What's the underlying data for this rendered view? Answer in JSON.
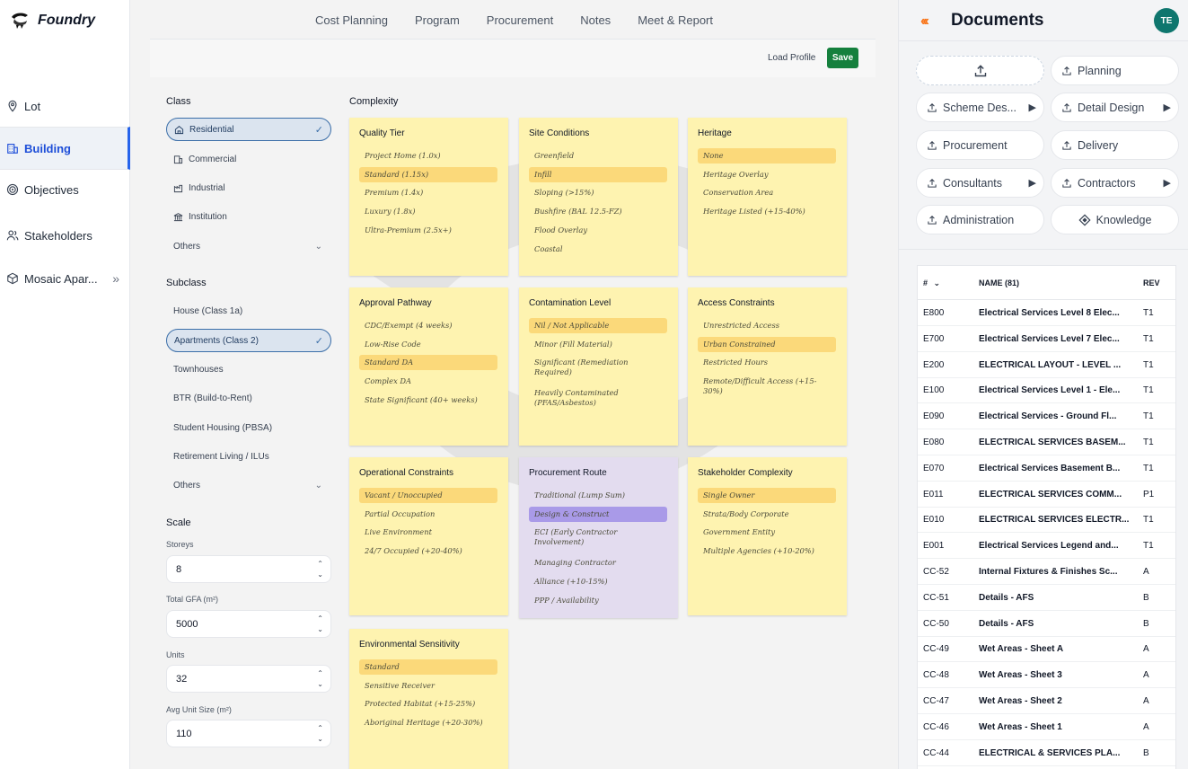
{
  "app": {
    "name": "Foundry"
  },
  "sidebar": {
    "items": [
      {
        "label": "Lot",
        "icon": "map-pin-icon"
      },
      {
        "label": "Building",
        "icon": "building-icon",
        "active": true
      },
      {
        "label": "Objectives",
        "icon": "target-icon"
      },
      {
        "label": "Stakeholders",
        "icon": "users-icon"
      },
      {
        "label": "Mosaic Apar...",
        "icon": "box-icon",
        "expand": "»"
      }
    ]
  },
  "topnav": {
    "tabs": [
      "Cost Planning",
      "Program",
      "Procurement",
      "Notes",
      "Meet & Report"
    ]
  },
  "toolbar": {
    "load_profile": "Load Profile",
    "save": "Save"
  },
  "class_section": {
    "label": "Class",
    "options": [
      {
        "label": "Residential",
        "selected": true
      },
      {
        "label": "Commercial"
      },
      {
        "label": "Industrial"
      },
      {
        "label": "Institution"
      },
      {
        "label": "Others"
      }
    ]
  },
  "subclass_section": {
    "label": "Subclass",
    "options": [
      {
        "label": "House (Class 1a)"
      },
      {
        "label": "Apartments (Class 2)",
        "selected": true
      },
      {
        "label": "Townhouses"
      },
      {
        "label": "BTR (Build-to-Rent)"
      },
      {
        "label": "Student Housing (PBSA)"
      },
      {
        "label": "Retirement Living / ILUs"
      },
      {
        "label": "Others"
      }
    ]
  },
  "scale": {
    "label": "Scale",
    "fields": [
      {
        "label": "Storeys",
        "value": "8"
      },
      {
        "label": "Total GFA (m²)",
        "value": "5000"
      },
      {
        "label": "Units",
        "value": "32"
      },
      {
        "label": "Avg Unit Size (m²)",
        "value": "110"
      }
    ]
  },
  "complexity": {
    "label": "Complexity",
    "cards": [
      {
        "title": "Quality Tier",
        "options": [
          "Project Home (1.0x)",
          "Standard (1.15x)",
          "Premium (1.4x)",
          "Luxury (1.8x)",
          "Ultra-Premium (2.5x+)"
        ],
        "selected": 1
      },
      {
        "title": "Site Conditions",
        "options": [
          "Greenfield",
          "Infill",
          "Sloping (>15%)",
          "Bushfire (BAL 12.5-FZ)",
          "Flood Overlay",
          "Coastal"
        ],
        "selected": 1
      },
      {
        "title": "Heritage",
        "options": [
          "None",
          "Heritage Overlay",
          "Conservation Area",
          "Heritage Listed (+15-40%)"
        ],
        "selected": 0
      },
      {
        "title": "Approval Pathway",
        "options": [
          "CDC/Exempt (4 weeks)",
          "Low-Rise Code",
          "Standard DA",
          "Complex DA",
          "State Significant (40+ weeks)"
        ],
        "selected": 2
      },
      {
        "title": "Contamination Level",
        "options": [
          "Nil / Not Applicable",
          "Minor (Fill Material)",
          "Significant (Remediation Required)",
          "Heavily Contaminated (PFAS/Asbestos)"
        ],
        "selected": 0
      },
      {
        "title": "Access Constraints",
        "options": [
          "Unrestricted Access",
          "Urban Constrained",
          "Restricted Hours",
          "Remote/Difficult Access (+15-30%)"
        ],
        "selected": 1
      },
      {
        "title": "Operational Constraints",
        "options": [
          "Vacant / Unoccupied",
          "Partial Occupation",
          "Live Environment",
          "24/7 Occupied (+20-40%)"
        ],
        "selected": 0
      },
      {
        "title": "Procurement Route",
        "options": [
          "Traditional (Lump Sum)",
          "Design & Construct",
          "ECI (Early Contractor Involvement)",
          "Managing Contractor",
          "Alliance (+10-15%)",
          "PPP / Availability"
        ],
        "selected": 1,
        "purple": true
      },
      {
        "title": "Stakeholder Complexity",
        "options": [
          "Single Owner",
          "Strata/Body Corporate",
          "Government Entity",
          "Multiple Agencies (+10-20%)"
        ],
        "selected": 0
      },
      {
        "title": "Environmental Sensitivity",
        "options": [
          "Standard",
          "Sensitive Receiver",
          "Protected Habitat (+15-25%)",
          "Aboriginal Heritage (+20-30%)"
        ],
        "selected": 0
      }
    ]
  },
  "documents": {
    "title": "Documents",
    "avatar": "TE",
    "categories": [
      {
        "label": "",
        "type": "upload"
      },
      {
        "label": "Planning"
      },
      {
        "label": "Scheme Des...",
        "submenu": true
      },
      {
        "label": "Detail Design",
        "submenu": true
      },
      {
        "label": "Procurement"
      },
      {
        "label": "Delivery"
      },
      {
        "label": "Consultants",
        "submenu": true
      },
      {
        "label": "Contractors",
        "submenu": true
      },
      {
        "label": "Administration"
      },
      {
        "label": "Knowledge",
        "type": "knowledge"
      }
    ],
    "table": {
      "col_no": "#",
      "col_name": "NAME  (81)",
      "col_rev": "REV",
      "rows": [
        {
          "no": "E800",
          "name": "Electrical Services Level 8 Elec...",
          "rev": "T1"
        },
        {
          "no": "E700",
          "name": "Electrical Services Level 7 Elec...",
          "rev": "T1"
        },
        {
          "no": "E200",
          "name": "ELECTRICAL LAYOUT - LEVEL ...",
          "rev": "T1"
        },
        {
          "no": "E100",
          "name": "Electrical Services Level 1 - Ele...",
          "rev": "T1"
        },
        {
          "no": "E090",
          "name": "Electrical Services - Ground Fl...",
          "rev": "T1"
        },
        {
          "no": "E080",
          "name": "ELECTRICAL SERVICES BASEM...",
          "rev": "T1"
        },
        {
          "no": "E070",
          "name": "Electrical Services Basement B...",
          "rev": "T1"
        },
        {
          "no": "E011",
          "name": "ELECTRICAL SERVICES COMM...",
          "rev": "P1"
        },
        {
          "no": "E010",
          "name": "ELECTRICAL SERVICES ELECTR...",
          "rev": "T1"
        },
        {
          "no": "E001",
          "name": "Electrical Services Legend and...",
          "rev": "T1"
        },
        {
          "no": "CC-52",
          "name": "Internal Fixtures & Finishes Sc...",
          "rev": "A"
        },
        {
          "no": "CC-51",
          "name": "Details - AFS",
          "rev": "B"
        },
        {
          "no": "CC-50",
          "name": "Details - AFS",
          "rev": "B"
        },
        {
          "no": "CC-49",
          "name": "Wet Areas - Sheet A",
          "rev": "A"
        },
        {
          "no": "CC-48",
          "name": "Wet Areas - Sheet 3",
          "rev": "A"
        },
        {
          "no": "CC-47",
          "name": "Wet Areas - Sheet 2",
          "rev": "A"
        },
        {
          "no": "CC-46",
          "name": "Wet Areas - Sheet 1",
          "rev": "A"
        },
        {
          "no": "CC-44",
          "name": "ELECTRICAL & SERVICES PLA...",
          "rev": "B"
        }
      ]
    }
  },
  "colors": {
    "accent": "#2563eb",
    "save": "#15803d",
    "card": "#fef3b0",
    "card_selected": "#fbd97a",
    "card_purple": "#e3dcef",
    "avatar": "#0f766e"
  }
}
